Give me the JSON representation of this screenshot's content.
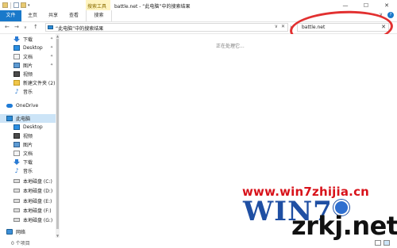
{
  "window": {
    "title": "battle.net - “此电脑”中的搜索结果",
    "contextual_group": "搜索工具",
    "controls": {
      "minimize": "—",
      "maximize": "☐",
      "close": "✕"
    }
  },
  "ribbon": {
    "tabs": [
      {
        "label": "文件"
      },
      {
        "label": "主页"
      },
      {
        "label": "共享"
      },
      {
        "label": "查看"
      },
      {
        "label": "搜索"
      }
    ],
    "expand_glyph": "∨",
    "help_glyph": "?"
  },
  "addressbar": {
    "back": "←",
    "forward": "→",
    "history": "∨",
    "up": "↑",
    "path": "“此电脑”中的搜索结果",
    "path_dropdown": "∨",
    "path_clear": "✕",
    "separator": "›"
  },
  "search": {
    "value": "battle.net",
    "clear": "✕"
  },
  "nav": {
    "items": [
      {
        "label": "下载",
        "icon": "download-icon",
        "pinned": true
      },
      {
        "label": "Desktop",
        "icon": "desktop-icon",
        "pinned": true
      },
      {
        "label": "文档",
        "icon": "documents-icon",
        "pinned": true
      },
      {
        "label": "图片",
        "icon": "pictures-icon",
        "pinned": true
      },
      {
        "label": "视频",
        "icon": "videos-icon",
        "pinned": false
      },
      {
        "label": "新建文件夹 (2)",
        "icon": "folder-icon",
        "pinned": false
      },
      {
        "label": "音乐",
        "icon": "music-icon",
        "pinned": false
      },
      {
        "label": "OneDrive",
        "icon": "onedrive-icon",
        "pinned": false
      },
      {
        "label": "此电脑",
        "icon": "this-pc-icon",
        "pinned": false,
        "selected": true
      },
      {
        "label": "Desktop",
        "icon": "desktop-icon",
        "pinned": false
      },
      {
        "label": "视频",
        "icon": "videos-icon",
        "pinned": false
      },
      {
        "label": "图片",
        "icon": "pictures-icon",
        "pinned": false
      },
      {
        "label": "文档",
        "icon": "documents-icon",
        "pinned": false
      },
      {
        "label": "下载",
        "icon": "download-icon",
        "pinned": false
      },
      {
        "label": "音乐",
        "icon": "music-icon",
        "pinned": false
      },
      {
        "label": "本地磁盘 (C:)",
        "icon": "drive-icon",
        "pinned": false
      },
      {
        "label": "本地磁盘 (D:)",
        "icon": "drive-icon",
        "pinned": false
      },
      {
        "label": "本地磁盘 (E:)",
        "icon": "drive-icon",
        "pinned": false
      },
      {
        "label": "本地磁盘 (F:)",
        "icon": "drive-icon",
        "pinned": false
      },
      {
        "label": "本地磁盘 (G:)",
        "icon": "drive-icon",
        "pinned": false
      },
      {
        "label": "网络",
        "icon": "network-icon",
        "pinned": false
      }
    ],
    "pin_glyph": "📌"
  },
  "content": {
    "working_text": "正在处理它..."
  },
  "status": {
    "count": "0 个项目"
  },
  "watermark": {
    "url": "www.win7zhijia.cn",
    "logo": "WIN7",
    "site": "zrkj.net"
  },
  "colors": {
    "accent": "#1979ca",
    "contextual": "#fff4c0",
    "selection": "#cce4f7",
    "annotation": "#e23030"
  }
}
